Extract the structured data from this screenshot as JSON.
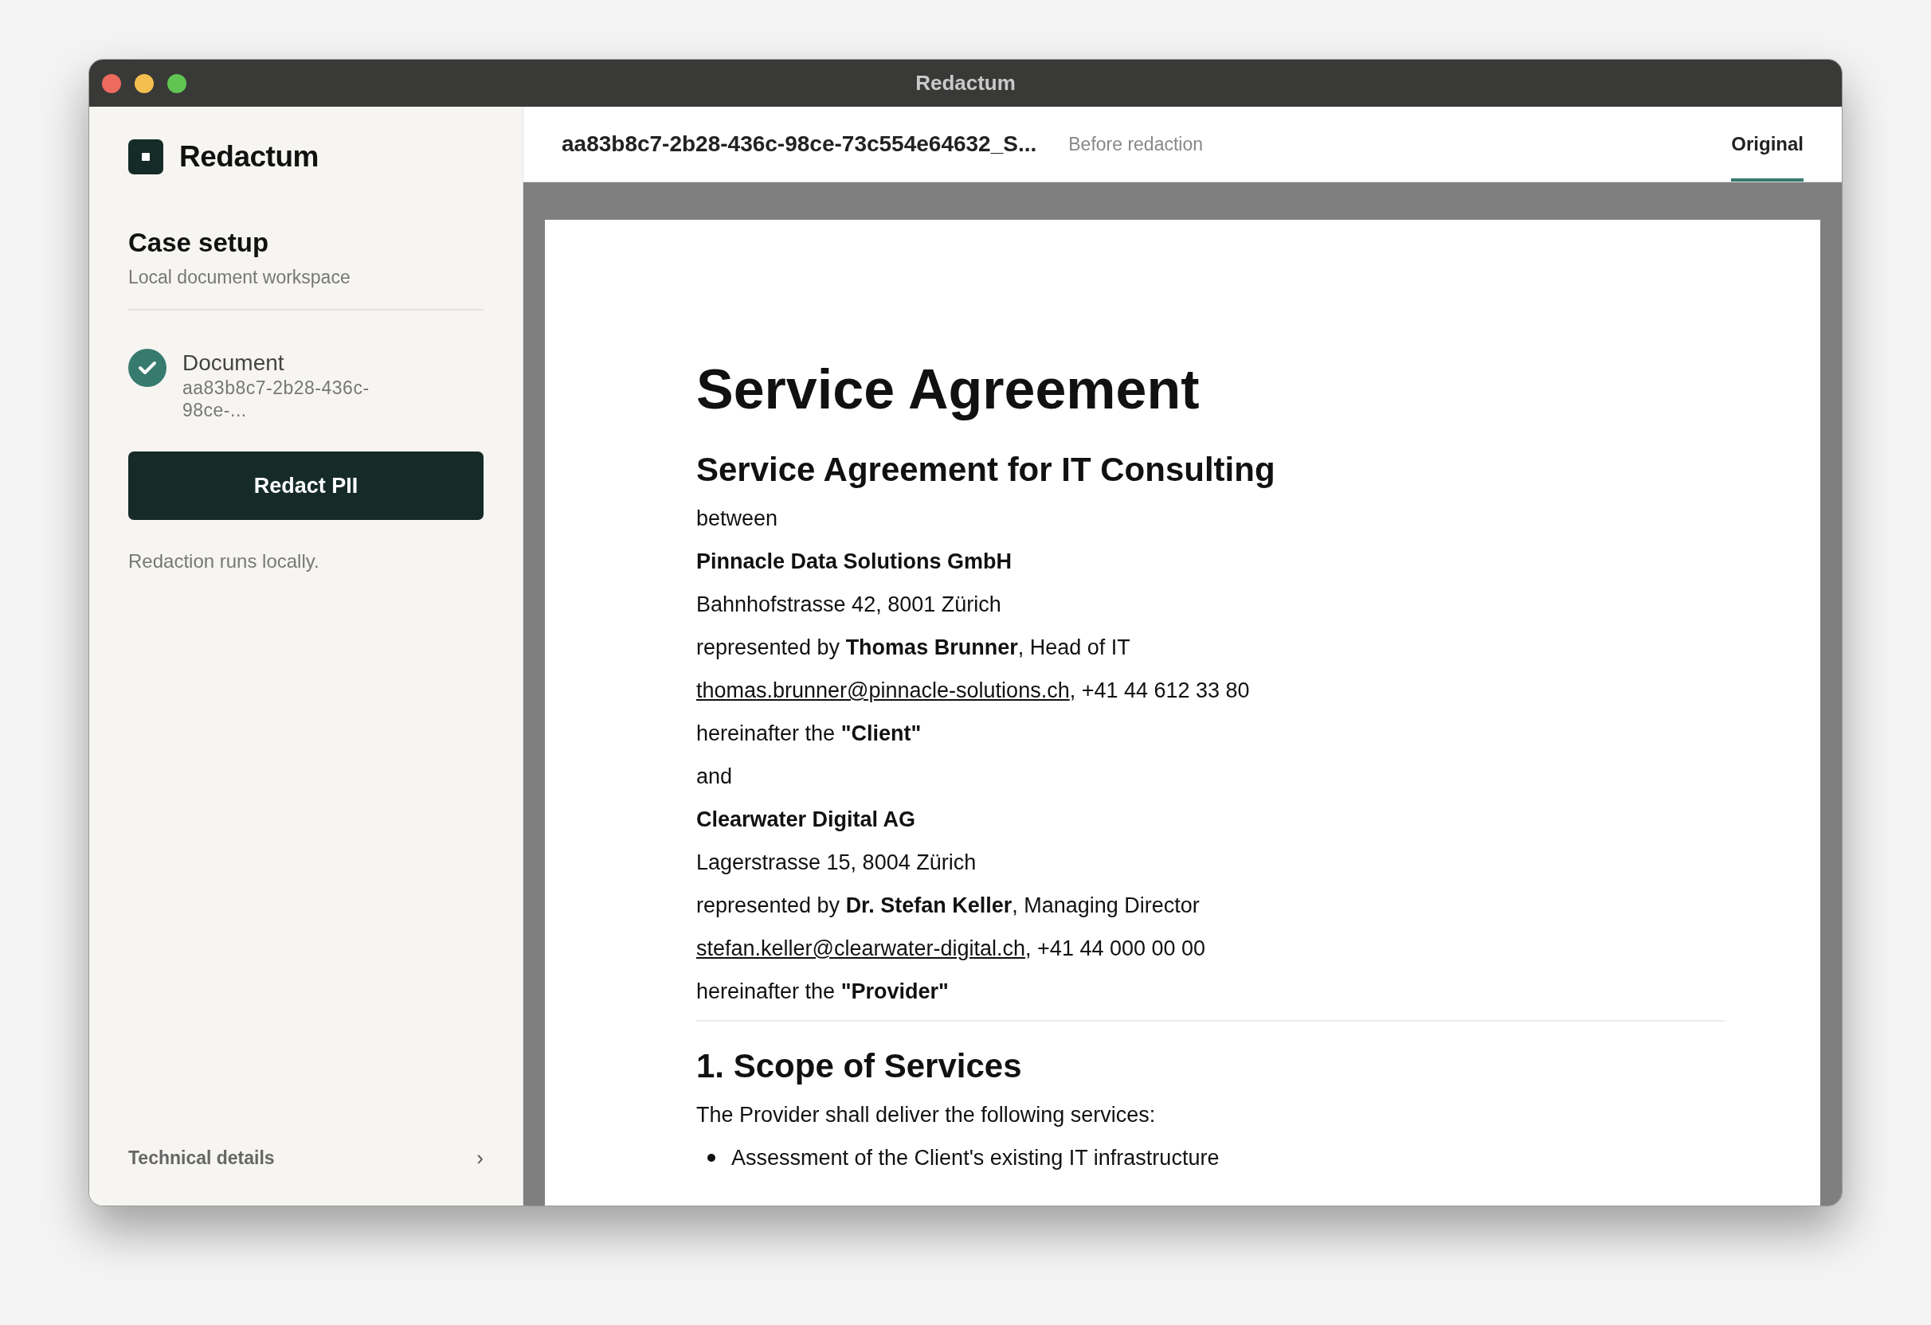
{
  "window": {
    "title": "Redactum"
  },
  "sidebar": {
    "brand": "Redactum",
    "section_title": "Case setup",
    "section_subtitle": "Local document workspace",
    "steps": [
      {
        "label": "Document",
        "detail": "aa83b8c7-2b28-436c-\n98ce-...",
        "done": true
      }
    ],
    "primary_button": "Redact PII",
    "note": "Redaction runs locally.",
    "footer_link": "Technical details",
    "footer_chevron": "›"
  },
  "tabbar": {
    "file_name": "aa83b8c7-2b28-436c-98ce-73c554e64632_S...",
    "status": "Before redaction",
    "tabs": [
      {
        "label": "Original",
        "selected": true
      }
    ]
  },
  "document": {
    "blocks": [
      {
        "kind": "title",
        "text": "Service Agreement"
      },
      {
        "kind": "subtitle",
        "text": "Service Agreement for IT Consulting"
      },
      {
        "kind": "paragraph",
        "text": "between"
      },
      {
        "kind": "strong",
        "text": "Pinnacle Data Solutions GmbH"
      },
      {
        "kind": "paragraph",
        "text": "Bahnhofstrasse 42, 8001 Zürich"
      },
      {
        "kind": "paragraph",
        "text": "represented by **Thomas Brunner**, Head of IT"
      },
      {
        "kind": "contact",
        "link": "thomas.brunner@pinnacle-solutions.ch",
        "text": ", +41 44 612 33 80"
      },
      {
        "kind": "paragraph",
        "text": "hereinafter the **\"Client\"**"
      },
      {
        "kind": "paragraph",
        "text": "and"
      },
      {
        "kind": "strong",
        "text": "Clearwater Digital AG"
      },
      {
        "kind": "paragraph",
        "text": "Lagerstrasse 15, 8004 Zürich"
      },
      {
        "kind": "paragraph",
        "text": "represented by **Dr. Stefan Keller**, Managing Director"
      },
      {
        "kind": "contact",
        "link": "stefan.keller@clearwater-digital.ch",
        "text": ", +41 44 000 00 00"
      },
      {
        "kind": "paragraph",
        "text": "hereinafter the **\"Provider\"**"
      },
      {
        "kind": "rule"
      },
      {
        "kind": "heading",
        "text": "1. Scope of Services"
      },
      {
        "kind": "paragraph",
        "text": "The Provider shall deliver the following services:"
      },
      {
        "kind": "bullet",
        "text": "Assessment of the Client's existing IT infrastructure"
      }
    ]
  }
}
